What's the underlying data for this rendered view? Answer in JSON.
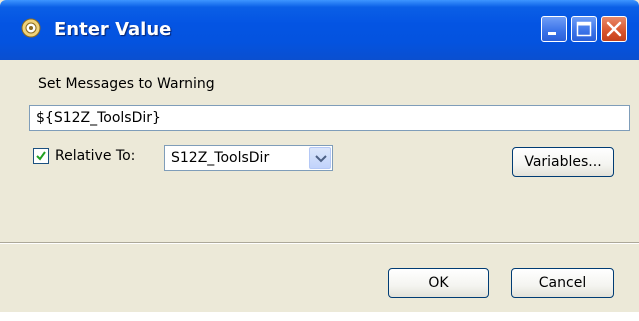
{
  "window": {
    "title": "Enter Value",
    "controls": {
      "minimize": "minimize-icon",
      "maximize": "maximize-icon",
      "close": "close-icon"
    }
  },
  "dialog": {
    "message": "Set Messages to Warning",
    "value": "${S12Z_ToolsDir}",
    "relative_to": {
      "label": "Relative To:",
      "checked": true,
      "selected": "S12Z_ToolsDir"
    },
    "variables_label": "Variables...",
    "ok_label": "OK",
    "cancel_label": "Cancel"
  },
  "colors": {
    "titlebar": "#0454e3",
    "window_bg": "#ece9d8",
    "close_button": "#d9542b",
    "button_border": "#003c74"
  }
}
